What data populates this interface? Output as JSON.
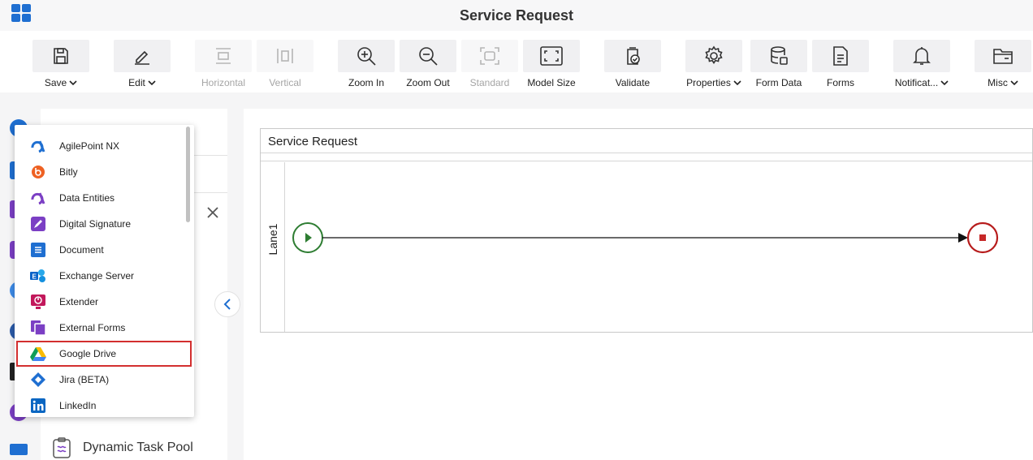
{
  "header": {
    "title": "Service Request"
  },
  "toolbar": {
    "save": "Save",
    "edit": "Edit",
    "horizontal": "Horizontal",
    "vertical": "Vertical",
    "zoom_in": "Zoom In",
    "zoom_out": "Zoom Out",
    "standard": "Standard",
    "model_size": "Model Size",
    "validate": "Validate",
    "properties": "Properties",
    "form_data": "Form Data",
    "forms": "Forms",
    "notifications": "Notificat...",
    "misc": "Misc"
  },
  "canvas": {
    "pool_title": "Service Request",
    "lane_label": "Lane1"
  },
  "panel": {
    "dynamic_task_pool": "Dynamic Task Pool"
  },
  "dropdown": {
    "items": [
      {
        "label": "AgilePoint NX",
        "icon": "agilepoint-icon"
      },
      {
        "label": "Bitly",
        "icon": "bitly-icon"
      },
      {
        "label": "Data Entities",
        "icon": "data-entities-icon"
      },
      {
        "label": "Digital Signature",
        "icon": "digital-signature-icon"
      },
      {
        "label": "Document",
        "icon": "document-icon"
      },
      {
        "label": "Exchange Server",
        "icon": "exchange-server-icon"
      },
      {
        "label": "Extender",
        "icon": "extender-icon"
      },
      {
        "label": "External Forms",
        "icon": "external-forms-icon"
      },
      {
        "label": "Google Drive",
        "icon": "google-drive-icon"
      },
      {
        "label": "Jira (BETA)",
        "icon": "jira-icon"
      },
      {
        "label": "LinkedIn",
        "icon": "linkedin-icon"
      }
    ],
    "selected": "Google Drive"
  },
  "colors": {
    "accent_blue": "#1f6fd1",
    "selected_border": "#d32f2f",
    "start_event": "#2e7d32",
    "end_event": "#c62828"
  }
}
